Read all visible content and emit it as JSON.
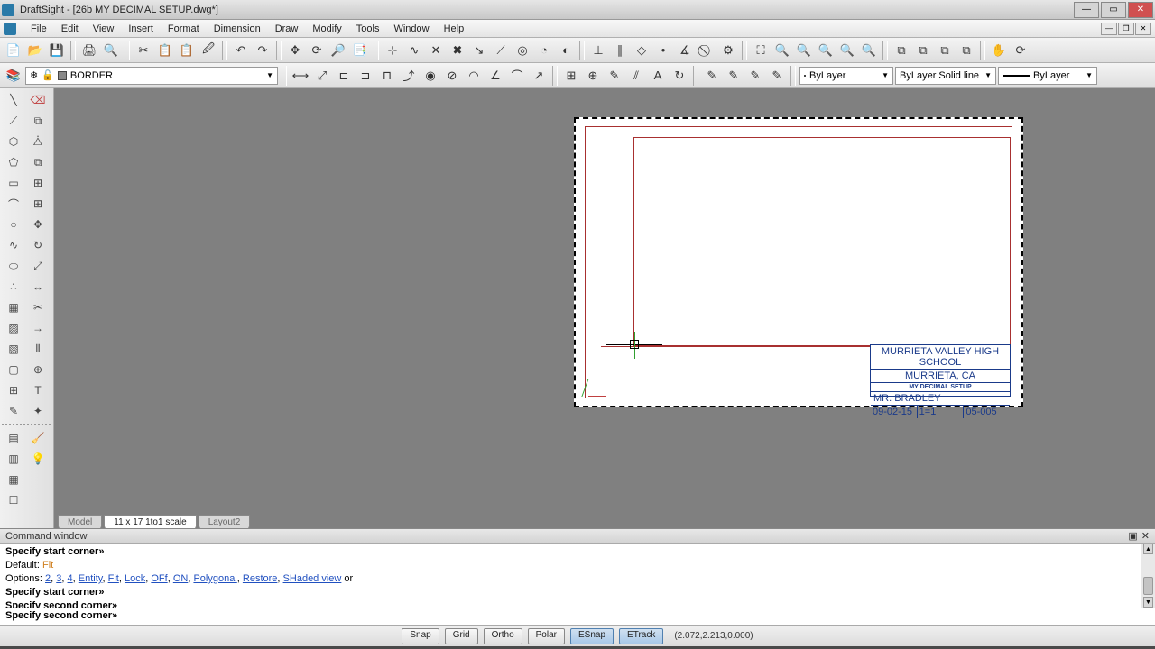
{
  "title": "DraftSight - [26b MY DECIMAL SETUP.dwg*]",
  "menu": [
    "File",
    "Edit",
    "View",
    "Insert",
    "Format",
    "Dimension",
    "Draw",
    "Modify",
    "Tools",
    "Window",
    "Help"
  ],
  "layer": {
    "current": "BORDER"
  },
  "props": {
    "color": "ByLayer",
    "linetype": "ByLayer   Solid line",
    "lineweight": "ByLayer"
  },
  "tabs": [
    "Model",
    "11 x 17 1to1 scale",
    "Layout2"
  ],
  "activeTab": 1,
  "titleblock": {
    "school": "MURRIETA VALLEY HIGH SCHOOL",
    "city": "MURRIETA, CA",
    "drawing": "MY DECIMAL SETUP",
    "by": "MR. BRADLEY",
    "date": "09-02-15",
    "scale": "1=1",
    "no": "05-005"
  },
  "cmd": {
    "title": "Command window",
    "lines": {
      "l1": "Specify start corner»",
      "l2a": "Default: ",
      "l2b": "Fit",
      "l3a": "Options: ",
      "opts": [
        "2",
        "3",
        "4",
        "Entity",
        "Fit",
        "Lock",
        "OFf",
        "ON",
        "Polygonal",
        "Restore",
        "SHaded view"
      ],
      "l3b": " or",
      "l4": "Specify start corner»",
      "l5": "Specify second corner»",
      "input": "Specify second corner»"
    }
  },
  "status": {
    "buttons": [
      {
        "label": "Snap",
        "on": false
      },
      {
        "label": "Grid",
        "on": false
      },
      {
        "label": "Ortho",
        "on": false
      },
      {
        "label": "Polar",
        "on": false
      },
      {
        "label": "ESnap",
        "on": true
      },
      {
        "label": "ETrack",
        "on": true
      }
    ],
    "coords": "(2.072,2.213,0.000)"
  }
}
